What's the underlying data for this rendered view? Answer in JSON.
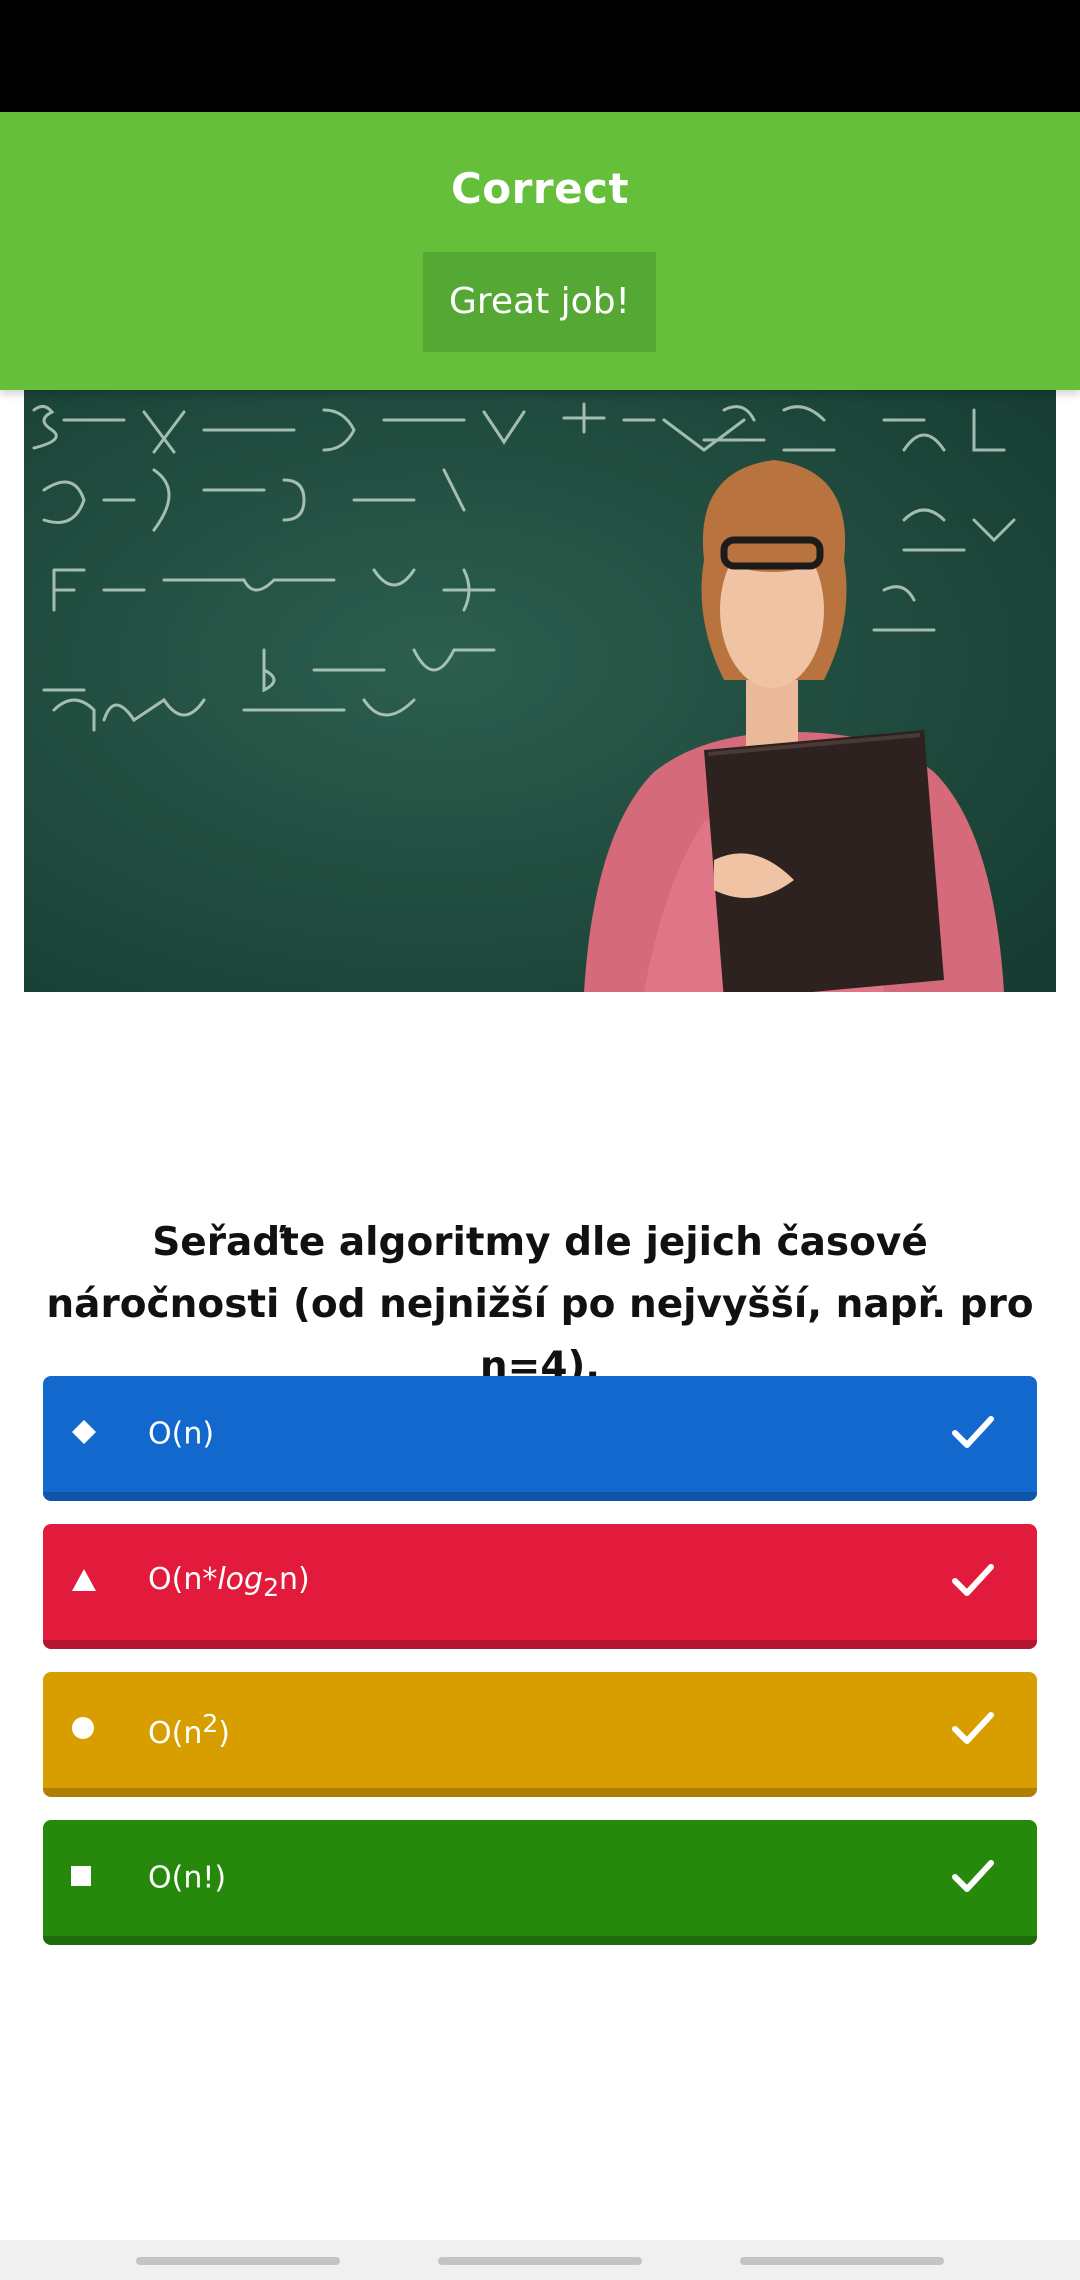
{
  "result": {
    "title": "Correct",
    "feedback_button": "Great job!",
    "accent_color": "#66bf3a"
  },
  "question": {
    "image_alt": "teacher-in-front-of-chalkboard",
    "text": "Seřaďte algoritmy dle jejich časové náročnosti (od nejnižší po nejvyšší, např. pro n=4)."
  },
  "answers": [
    {
      "shape": "diamond-icon",
      "color": "#1368ce",
      "parts": [
        "O(n)"
      ],
      "status_icon": "check-icon"
    },
    {
      "shape": "triangle-icon",
      "color": "#e21b3c",
      "parts": [
        "O(n*",
        "log",
        "2",
        "n)"
      ],
      "status_icon": "check-icon"
    },
    {
      "shape": "circle-icon",
      "color": "#d89e00",
      "parts": [
        "O(n",
        "2",
        ")"
      ],
      "status_icon": "check-icon"
    },
    {
      "shape": "square-icon",
      "color": "#26890c",
      "parts": [
        "O(n!)"
      ],
      "status_icon": "check-icon"
    }
  ]
}
